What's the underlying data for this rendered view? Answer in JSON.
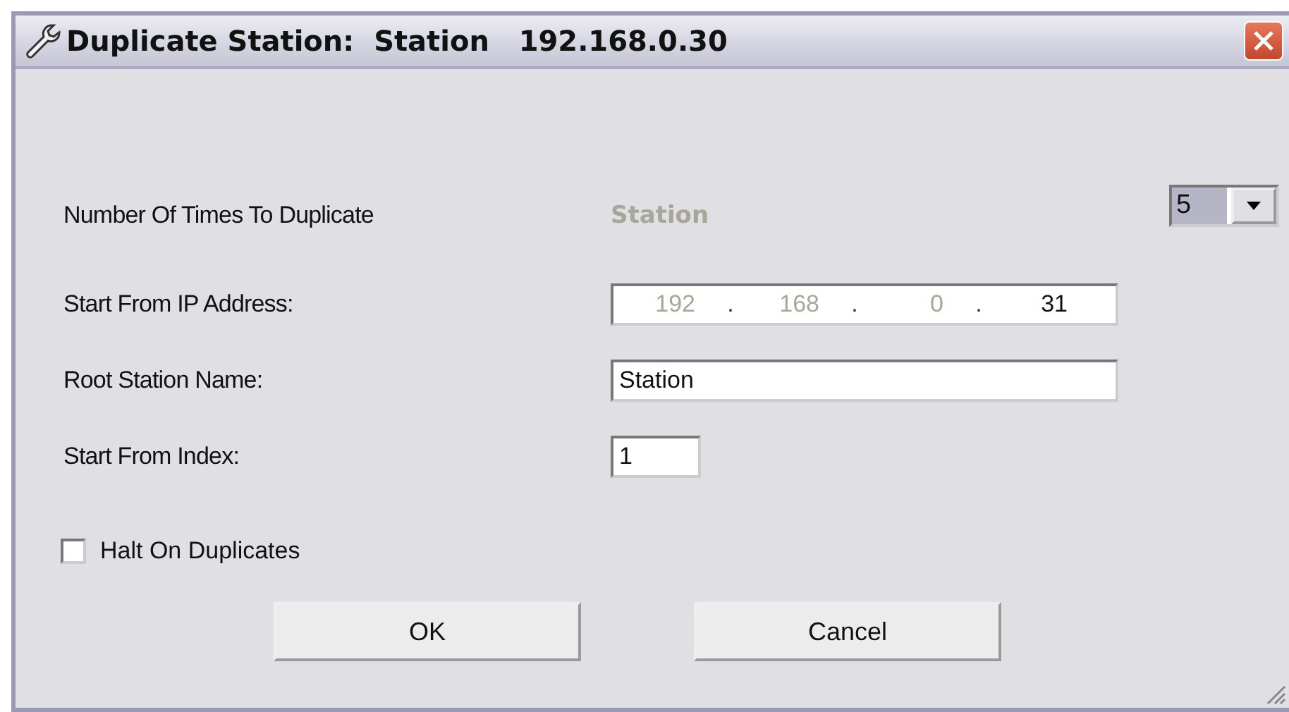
{
  "window": {
    "title": "Duplicate Station:  Station   192.168.0.30"
  },
  "fields": [
    {
      "kind": "combo",
      "label": "Number Of Times To Duplicate",
      "hint": "Station",
      "value": "5"
    },
    {
      "kind": "ip",
      "label": "Start From IP Address:",
      "octets": [
        {
          "text": "192",
          "disabled": true
        },
        {
          "text": "168",
          "disabled": true
        },
        {
          "text": "0",
          "disabled": true
        },
        {
          "text": "31",
          "disabled": false
        }
      ],
      "separator": "."
    },
    {
      "kind": "text",
      "label": "Root Station Name:",
      "value": "Station"
    },
    {
      "kind": "short",
      "label": "Start From Index:",
      "value": "1"
    }
  ],
  "halt_on_duplicates": {
    "label": "Halt On Duplicates",
    "checked": false
  },
  "buttons": [
    "OK",
    "Cancel"
  ]
}
